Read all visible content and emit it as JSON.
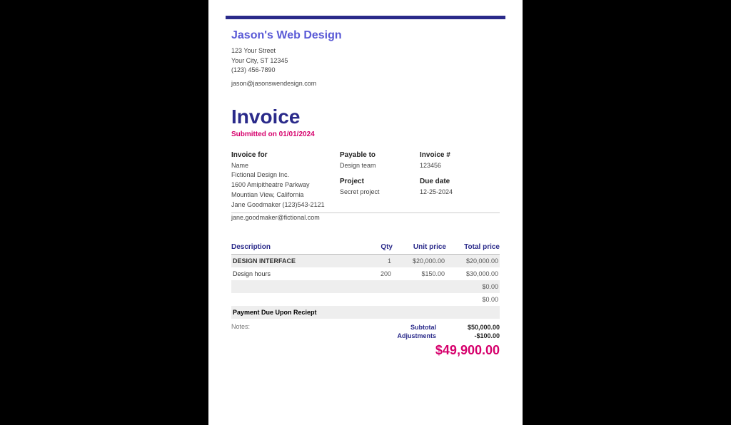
{
  "company": {
    "name": "Jason's Web Design",
    "street": "123 Your Street",
    "city": "Your City, ST 12345",
    "phone": "(123) 456-7890",
    "email": "jason@jasonswendesign.com"
  },
  "title": "Invoice",
  "submitted": "Submitted on 01/01/2024",
  "labels": {
    "invoice_for": "Invoice for",
    "payable_to": "Payable to",
    "invoice_num": "Invoice #",
    "project": "Project",
    "due_date": "Due date",
    "description": "Description",
    "qty": "Qty",
    "unit_price": "Unit price",
    "total_price": "Total price",
    "notes": "Notes:",
    "subtotal": "Subtotal",
    "adjustments": "Adjustments"
  },
  "invoice_for": {
    "name": "Name",
    "company": "Fictional Design Inc.",
    "street": "1600 Amipitheatre Parkway",
    "city": "Mountian View, California",
    "contact": "Jane Goodmaker  (123)543-2121",
    "email": "jane.goodmaker@fictional.com"
  },
  "payable_to": "Design team",
  "invoice_number": "123456",
  "project": "Secret project",
  "due_date": "12-25-2024",
  "items": [
    {
      "desc": "DESIGN INTERFACE",
      "qty": "1",
      "unit": "$20,000.00",
      "total": "$20,000.00"
    },
    {
      "desc": "Design hours",
      "qty": "200",
      "unit": "$150.00",
      "total": "$30,000.00"
    },
    {
      "desc": "",
      "qty": "",
      "unit": "",
      "total": "$0.00"
    },
    {
      "desc": "",
      "qty": "",
      "unit": "",
      "total": "$0.00"
    }
  ],
  "payment_note": "Payment Due Upon Reciept",
  "subtotal": "$50,000.00",
  "adjustments": "-$100.00",
  "grand_total": "$49,900.00"
}
